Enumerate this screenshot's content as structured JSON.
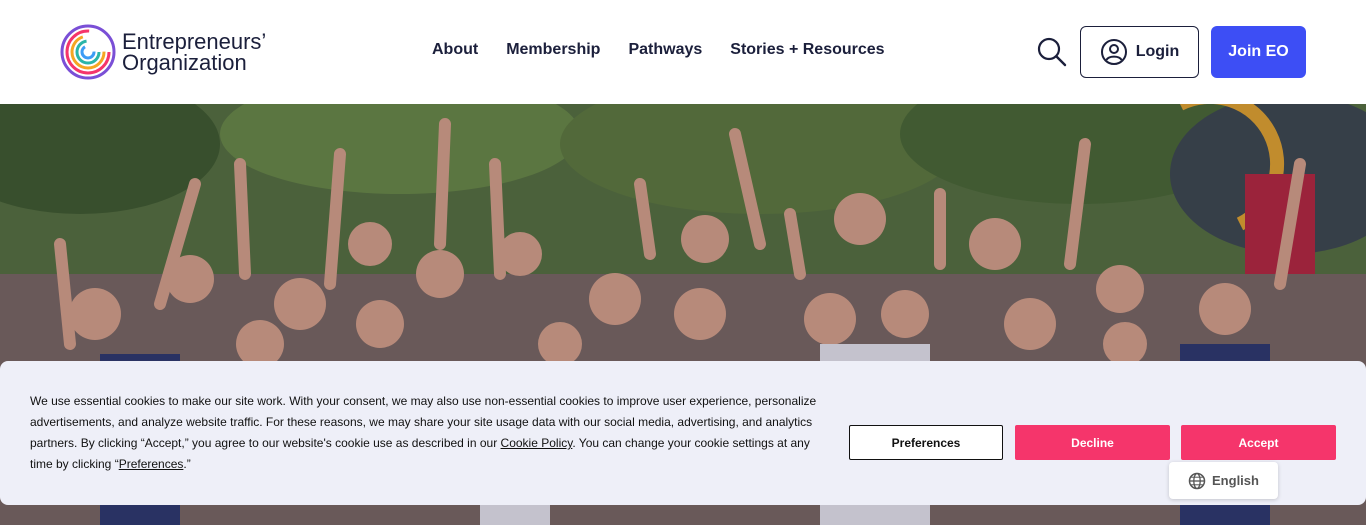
{
  "header": {
    "logo": {
      "line1": "Entrepreneurs’",
      "line2": "Organization"
    },
    "nav": [
      {
        "label": "About"
      },
      {
        "label": "Membership"
      },
      {
        "label": "Pathways"
      },
      {
        "label": "Stories + Resources"
      }
    ],
    "search_icon": "search-icon",
    "login_label": "Login",
    "join_label": "Join EO",
    "colors": {
      "primary": "#3d4ef5",
      "text": "#1b1f3b"
    }
  },
  "hero": {
    "image": "group-photo-people-waving"
  },
  "cookie_banner": {
    "text_before_link": "We use essential cookies to make our site work. With your consent, we may also use non-essential cookies to improve user experience, personalize advertisements, and analyze website traffic. For these reasons, we may share your site usage data with our social media, advertising, and analytics partners. By clicking “Accept,” you agree to our website's cookie use as described in our ",
    "link1": "Cookie Policy",
    "text_middle": ". You can change your cookie settings at any time by clicking “",
    "link2": "Preferences",
    "text_end": ".”",
    "preferences_label": "Preferences",
    "decline_label": "Decline",
    "accept_label": "Accept",
    "colors": {
      "accent": "#f5356b",
      "background": "#eeeff8"
    }
  },
  "language": {
    "label": "English",
    "icon": "globe-icon"
  }
}
